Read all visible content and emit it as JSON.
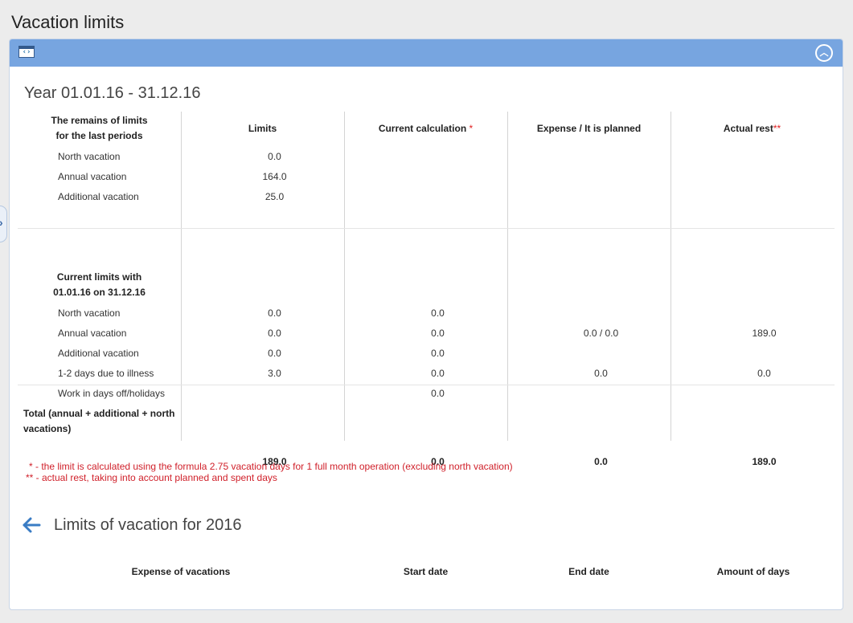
{
  "page": {
    "title": "Vacation limits"
  },
  "panel": {
    "window_icon": "window-code-icon",
    "window_icon_glyph": "‹›",
    "collapse_icon": "chevron-up-circle-icon",
    "collapse_glyph": "︿"
  },
  "side_toggle": {
    "glyph": "›"
  },
  "year": {
    "title": "Year 01.01.16 - 31.12.16"
  },
  "table": {
    "columns": {
      "limits": "Limits",
      "current_calc": "Current calculation",
      "expense": "Expense / It is planned",
      "actual_rest": "Actual rest"
    },
    "markers": {
      "single": "*",
      "double": "**"
    },
    "remains": {
      "title_line1": "The remains of limits",
      "title_line2": "for the last periods",
      "rows": [
        {
          "label": "North vacation",
          "limits": "0.0"
        },
        {
          "label": "Annual vacation",
          "limits": "164.0"
        },
        {
          "label": "Additional vacation",
          "limits": "25.0"
        }
      ]
    },
    "current": {
      "title_line1": "Current limits with",
      "title_line2": "01.01.16 on 31.12.16",
      "rows": [
        {
          "label": "North vacation",
          "limits": "0.0",
          "calc": "0.0",
          "expense": "",
          "rest": ""
        },
        {
          "label": "Annual vacation",
          "limits": "0.0",
          "calc": "0.0",
          "expense": "0.0 / 0.0",
          "rest": "189.0"
        },
        {
          "label": "Additional vacation",
          "limits": "0.0",
          "calc": "0.0",
          "expense": "",
          "rest": ""
        },
        {
          "label": "1-2 days due to illness",
          "limits": "3.0",
          "calc": "0.0",
          "expense": "0.0",
          "rest": "0.0"
        },
        {
          "label": "Work in days off/holidays",
          "limits": "",
          "calc": "0.0",
          "expense": "",
          "rest": ""
        }
      ]
    },
    "total": {
      "label_line1": "Total (annual + additional + north",
      "label_line2": "vacations)",
      "limits": "189.0",
      "calc": "0.0",
      "expense": "0.0",
      "rest": "189.0"
    }
  },
  "notes": {
    "note1": "* - the limit is calculated using the formula 2.75 vacation days for 1 full month operation (excluding north vacation)",
    "note2": "** - actual rest, taking into account planned and spent days"
  },
  "limits_section": {
    "title": "Limits of vacation for 2016",
    "back_icon": "arrow-left-icon",
    "columns": {
      "expense": "Expense of vacations",
      "start": "Start date",
      "end": "End date",
      "amount": "Amount of days"
    }
  },
  "colors": {
    "header_bar": "#77a5e0",
    "accent_blue": "#3a7cc4",
    "note_red": "#d0202a"
  }
}
